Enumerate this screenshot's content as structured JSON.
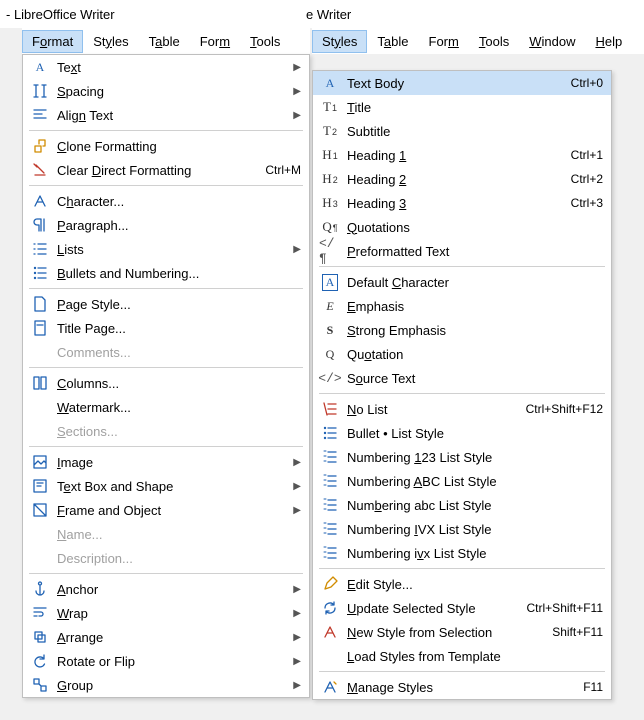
{
  "app": {
    "title_left": "- LibreOffice Writer",
    "title_right": "e Writer"
  },
  "menubar_left": {
    "items": [
      {
        "label": "Format",
        "ul": "o",
        "highlighted": true
      },
      {
        "label": "Styles",
        "ul": "y"
      },
      {
        "label": "Table",
        "ul": "a"
      },
      {
        "label": "Form",
        "ul": "m"
      },
      {
        "label": "Tools",
        "ul": "T"
      }
    ]
  },
  "menubar_right": {
    "items": [
      {
        "label": "Styles",
        "ul": "y",
        "highlighted": true
      },
      {
        "label": "Table",
        "ul": "a"
      },
      {
        "label": "Form",
        "ul": "m"
      },
      {
        "label": "Tools",
        "ul": "T"
      },
      {
        "label": "Window",
        "ul": "W"
      },
      {
        "label": "Help",
        "ul": "H"
      }
    ]
  },
  "format_menu": {
    "groups": [
      [
        {
          "icon": "text",
          "label": "Text",
          "ul": "x",
          "submenu": true
        },
        {
          "icon": "spacing",
          "label": "Spacing",
          "ul": "S",
          "submenu": true
        },
        {
          "icon": "align",
          "label": "Align Text",
          "ul": "n",
          "submenu": true
        }
      ],
      [
        {
          "icon": "clone",
          "label": "Clone Formatting",
          "ul": "C"
        },
        {
          "icon": "clear",
          "label": "Clear Direct Formatting",
          "ul": "D",
          "shortcut": "Ctrl+M"
        }
      ],
      [
        {
          "icon": "character",
          "label": "Character...",
          "ul": "h"
        },
        {
          "icon": "paragraph",
          "label": "Paragraph...",
          "ul": "P"
        },
        {
          "icon": "lists",
          "label": "Lists",
          "ul": "L",
          "submenu": true
        },
        {
          "icon": "bullets",
          "label": "Bullets and Numbering...",
          "ul": "B"
        }
      ],
      [
        {
          "icon": "pagestyle",
          "label": "Page Style...",
          "ul": "P"
        },
        {
          "icon": "titlepage",
          "label": "Title Page...",
          "ul": ""
        },
        {
          "icon": "",
          "label": "Comments...",
          "ul": "",
          "disabled": true
        }
      ],
      [
        {
          "icon": "columns",
          "label": "Columns...",
          "ul": "C"
        },
        {
          "icon": "",
          "label": "Watermark...",
          "ul": "W"
        },
        {
          "icon": "",
          "label": "Sections...",
          "ul": "S",
          "disabled": true
        }
      ],
      [
        {
          "icon": "image",
          "label": "Image",
          "ul": "I",
          "submenu": true
        },
        {
          "icon": "textbox",
          "label": "Text Box and Shape",
          "ul": "e",
          "submenu": true
        },
        {
          "icon": "frame",
          "label": "Frame and Object",
          "ul": "F",
          "submenu": true
        },
        {
          "icon": "",
          "label": "Name...",
          "ul": "N",
          "disabled": true
        },
        {
          "icon": "",
          "label": "Description...",
          "ul": "",
          "disabled": true
        }
      ],
      [
        {
          "icon": "anchor",
          "label": "Anchor",
          "ul": "A",
          "submenu": true
        },
        {
          "icon": "wrap",
          "label": "Wrap",
          "ul": "W",
          "submenu": true
        },
        {
          "icon": "arrange",
          "label": "Arrange",
          "ul": "A",
          "submenu": true
        },
        {
          "icon": "rotate",
          "label": "Rotate or Flip",
          "ul": "",
          "submenu": true
        },
        {
          "icon": "group",
          "label": "Group",
          "ul": "G",
          "submenu": true
        }
      ]
    ]
  },
  "styles_menu": {
    "groups": [
      [
        {
          "icon": "Aq",
          "label": "Text Body",
          "shortcut": "Ctrl+0",
          "highlighted": true
        },
        {
          "icon": "T1",
          "sub": "1",
          "label": "Title",
          "ul": "T"
        },
        {
          "icon": "T2",
          "sub": "2",
          "label": "Subtitle"
        },
        {
          "icon": "H1",
          "sub": "1",
          "label": "Heading 1",
          "ul": "1",
          "shortcut": "Ctrl+1"
        },
        {
          "icon": "H2",
          "sub": "2",
          "label": "Heading 2",
          "ul": "2",
          "shortcut": "Ctrl+2"
        },
        {
          "icon": "H3",
          "sub": "3",
          "label": "Heading 3",
          "ul": "3",
          "shortcut": "Ctrl+3"
        },
        {
          "icon": "Qp",
          "label": "Quotations",
          "ul": "Q"
        },
        {
          "icon": "Pre",
          "label": "Preformatted Text",
          "ul": "P"
        }
      ],
      [
        {
          "icon": "DefA",
          "label": "Default Character",
          "ul": "C"
        },
        {
          "icon": "Em",
          "label": "Emphasis",
          "ul": "E"
        },
        {
          "icon": "Strong",
          "label": "Strong Emphasis",
          "ul": "S"
        },
        {
          "icon": "Qc",
          "label": "Quotation",
          "ul": "o"
        },
        {
          "icon": "Src",
          "label": "Source Text",
          "ul": "o"
        }
      ],
      [
        {
          "icon": "nolist",
          "label": "No List",
          "ul": "N",
          "shortcut": "Ctrl+Shift+F12"
        },
        {
          "icon": "bulletlist",
          "label": "Bullet • List Style"
        },
        {
          "icon": "numlist",
          "label": "Numbering 123 List Style",
          "ul": "1"
        },
        {
          "icon": "abclist",
          "label": "Numbering ABC List Style",
          "ul": "A"
        },
        {
          "icon": "abc2list",
          "label": "Numbering abc List Style",
          "ul": "b"
        },
        {
          "icon": "ivxlist",
          "label": "Numbering IVX List Style",
          "ul": "I"
        },
        {
          "icon": "ivx2list",
          "label": "Numbering ivx List Style",
          "ul": "v"
        }
      ],
      [
        {
          "icon": "edit",
          "label": "Edit Style...",
          "ul": "E"
        },
        {
          "icon": "update",
          "label": "Update Selected Style",
          "ul": "U",
          "shortcut": "Ctrl+Shift+F11"
        },
        {
          "icon": "new",
          "label": "New Style from Selection",
          "ul": "N",
          "shortcut": "Shift+F11"
        },
        {
          "icon": "",
          "label": "Load Styles from Template",
          "ul": "L"
        }
      ],
      [
        {
          "icon": "manage",
          "label": "Manage Styles",
          "ul": "M",
          "shortcut": "F11"
        }
      ]
    ]
  }
}
